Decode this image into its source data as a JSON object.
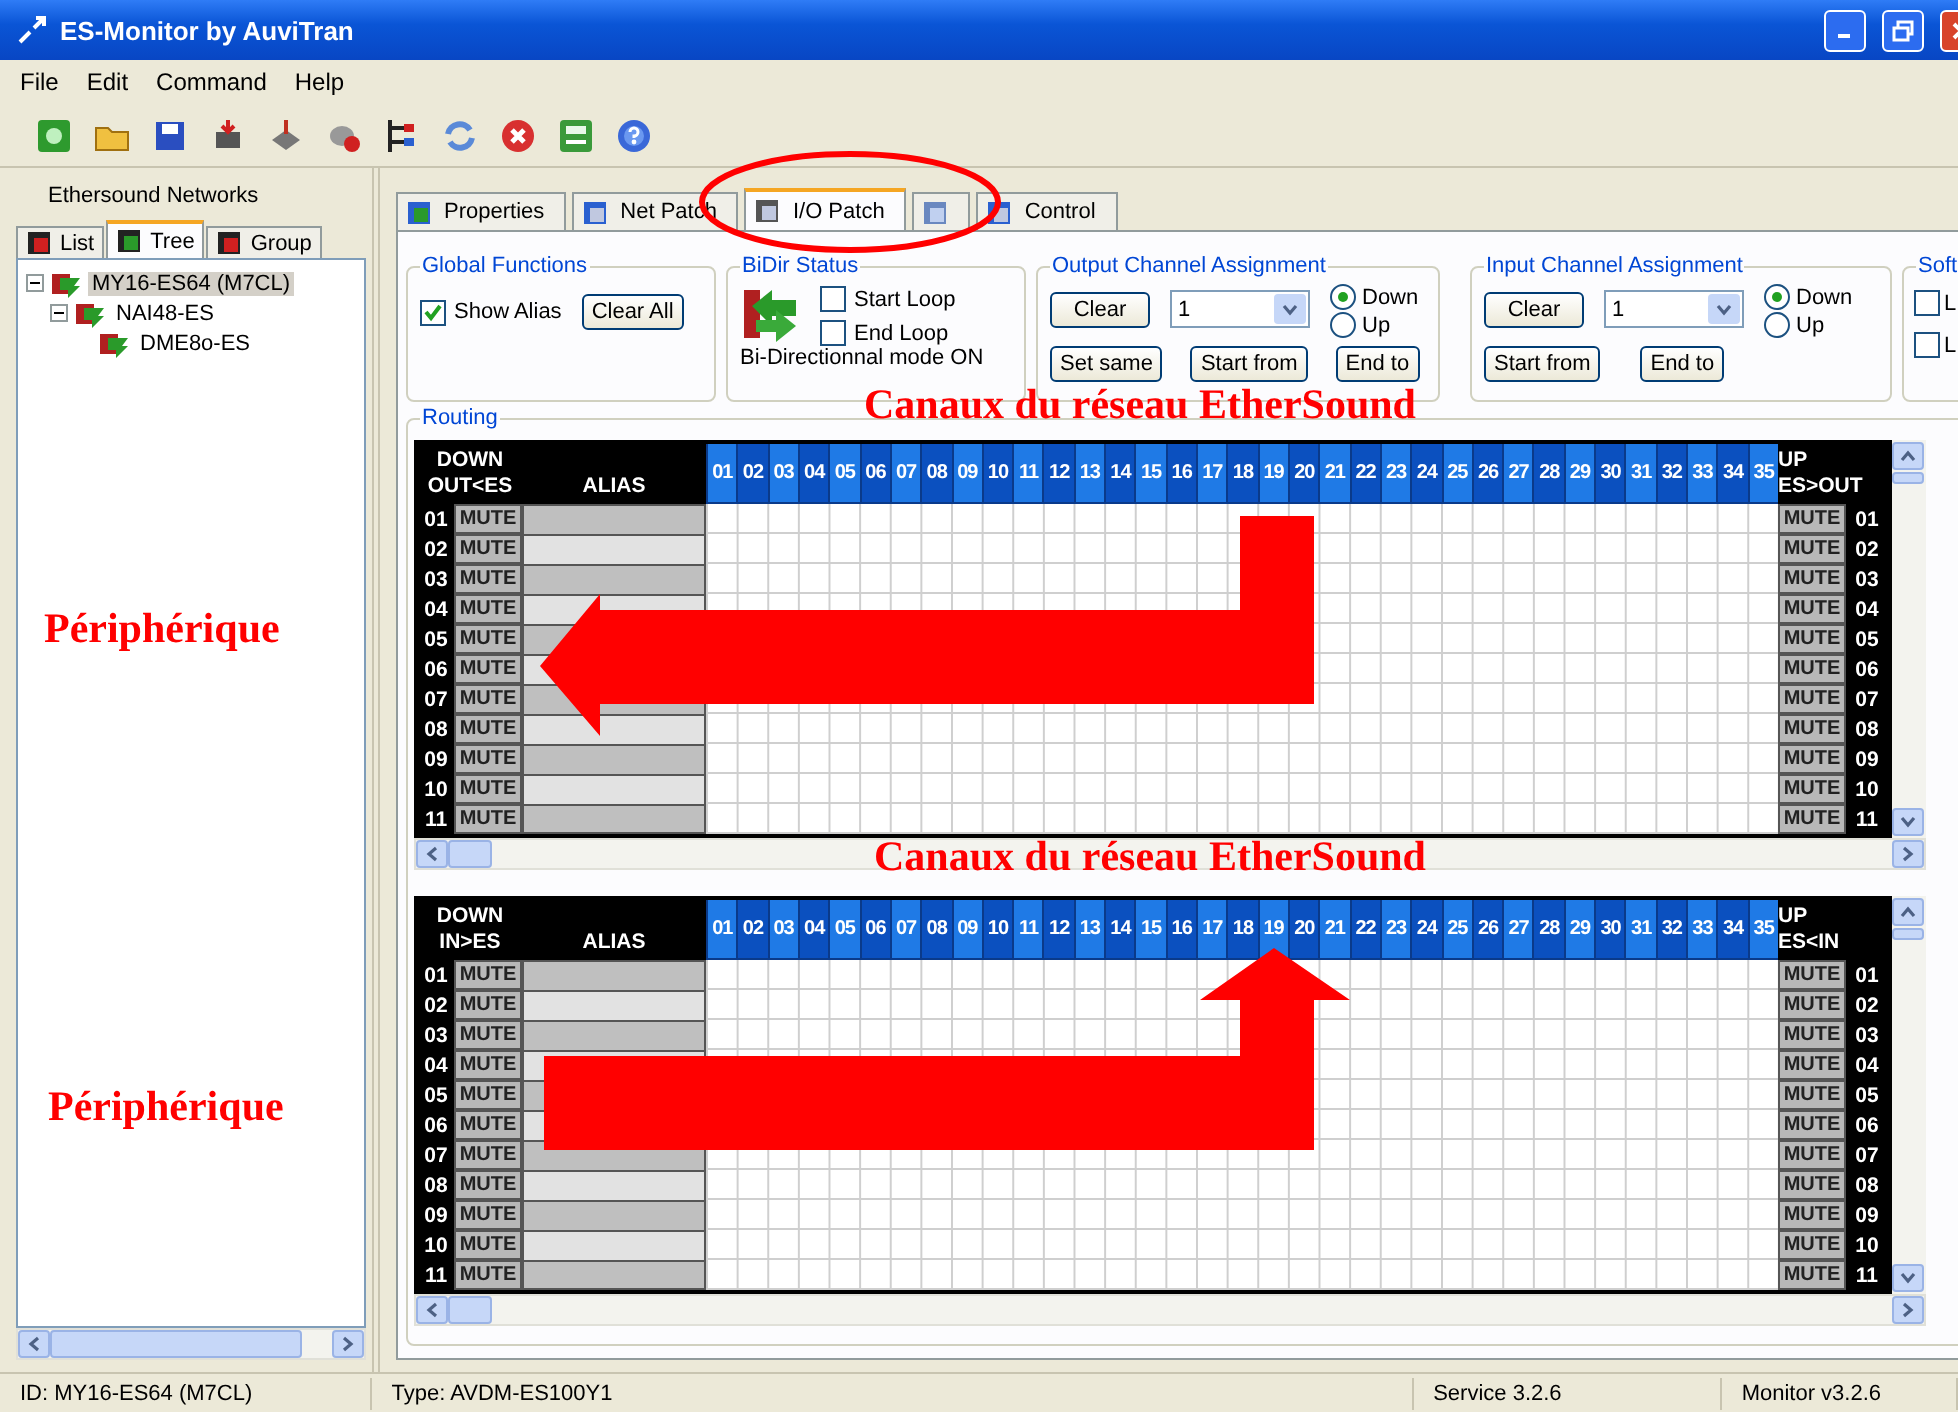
{
  "window": {
    "title": "ES-Monitor by AuviTran"
  },
  "menu": [
    "File",
    "Edit",
    "Command",
    "Help"
  ],
  "sidebar": {
    "title": "Ethersound Networks",
    "tabs": [
      {
        "label": "List",
        "selected": false
      },
      {
        "label": "Tree",
        "selected": true
      },
      {
        "label": "Group",
        "selected": false
      }
    ],
    "tree": [
      {
        "label": "MY16-ES64 (M7CL)",
        "selected": true,
        "expanded": true,
        "children": [
          {
            "label": "NAI48-ES",
            "selected": false,
            "expanded": true,
            "children": [
              {
                "label": "DME8o-ES",
                "selected": false
              }
            ]
          }
        ]
      }
    ]
  },
  "tabs": [
    {
      "kind": "text",
      "label": "Properties",
      "selected": false
    },
    {
      "kind": "text",
      "label": "Net Patch",
      "selected": false
    },
    {
      "kind": "text",
      "label": "I/O Patch",
      "selected": true
    },
    {
      "kind": "icon",
      "selected": false
    },
    {
      "kind": "text",
      "label": "Control",
      "selected": false
    }
  ],
  "global_functions": {
    "title": "Global Functions",
    "show_alias": {
      "label": "Show Alias",
      "checked": true
    },
    "button": "Clear All"
  },
  "bidir_status": {
    "title": "BiDir Status",
    "start_loop": {
      "label": "Start Loop",
      "checked": false
    },
    "end_loop": {
      "label": "End Loop",
      "checked": false
    },
    "mode": "Bi-Directionnal mode ON"
  },
  "assignments": [
    {
      "title": "Output Channel Assignment",
      "clear": "Clear",
      "value": "1",
      "radios": [
        {
          "label": "Down",
          "selected": true
        },
        {
          "label": "Up",
          "selected": false
        }
      ],
      "buttons": [
        "Set same",
        "Start from",
        "End to"
      ]
    },
    {
      "title": "Input Channel Assignment",
      "clear": "Clear",
      "value": "1",
      "radios": [
        {
          "label": "Down",
          "selected": true
        },
        {
          "label": "Up",
          "selected": false
        }
      ],
      "buttons": [
        "Start from",
        "End to"
      ]
    }
  ],
  "soft": {
    "title": "Soft",
    "checkboxes": [
      {
        "label": "L",
        "checked": false
      },
      {
        "label": "L",
        "checked": false
      }
    ]
  },
  "routing": {
    "title": "Routing",
    "grids": [
      {
        "left_top": "DOWN",
        "left_bottom": "OUT<ES",
        "alias": "ALIAS",
        "right_top": "UP",
        "right_bottom": "ES>OUT",
        "channels": [
          "01",
          "02",
          "03",
          "04",
          "05",
          "06",
          "07",
          "08",
          "09",
          "10",
          "11",
          "12",
          "13",
          "14",
          "15",
          "16",
          "17",
          "18",
          "19",
          "20",
          "21",
          "22",
          "23",
          "24",
          "25",
          "26",
          "27",
          "28",
          "29",
          "30",
          "31",
          "32",
          "33",
          "34",
          "35"
        ],
        "rows": [
          {
            "left_number": "01",
            "left_mute": "MUTE",
            "right_mute": "MUTE",
            "right_number": "01"
          },
          {
            "left_number": "02",
            "left_mute": "MUTE",
            "right_mute": "MUTE",
            "right_number": "02"
          },
          {
            "left_number": "03",
            "left_mute": "MUTE",
            "right_mute": "MUTE",
            "right_number": "03"
          },
          {
            "left_number": "04",
            "left_mute": "MUTE",
            "right_mute": "MUTE",
            "right_number": "04"
          },
          {
            "left_number": "05",
            "left_mute": "MUTE",
            "right_mute": "MUTE",
            "right_number": "05"
          },
          {
            "left_number": "06",
            "left_mute": "MUTE",
            "right_mute": "MUTE",
            "right_number": "06"
          },
          {
            "left_number": "07",
            "left_mute": "MUTE",
            "right_mute": "MUTE",
            "right_number": "07"
          },
          {
            "left_number": "08",
            "left_mute": "MUTE",
            "right_mute": "MUTE",
            "right_number": "08"
          },
          {
            "left_number": "09",
            "left_mute": "MUTE",
            "right_mute": "MUTE",
            "right_number": "09"
          },
          {
            "left_number": "10",
            "left_mute": "MUTE",
            "right_mute": "MUTE",
            "right_number": "10"
          },
          {
            "left_number": "11",
            "left_mute": "MUTE",
            "right_mute": "MUTE",
            "right_number": "11"
          }
        ]
      },
      {
        "left_top": "DOWN",
        "left_bottom": "IN>ES",
        "alias": "ALIAS",
        "right_top": "UP",
        "right_bottom": "ES<IN",
        "channels": [
          "01",
          "02",
          "03",
          "04",
          "05",
          "06",
          "07",
          "08",
          "09",
          "10",
          "11",
          "12",
          "13",
          "14",
          "15",
          "16",
          "17",
          "18",
          "19",
          "20",
          "21",
          "22",
          "23",
          "24",
          "25",
          "26",
          "27",
          "28",
          "29",
          "30",
          "31",
          "32",
          "33",
          "34",
          "35"
        ],
        "rows": [
          {
            "left_number": "01",
            "left_mute": "MUTE",
            "right_mute": "MUTE",
            "right_number": "01"
          },
          {
            "left_number": "02",
            "left_mute": "MUTE",
            "right_mute": "MUTE",
            "right_number": "02"
          },
          {
            "left_number": "03",
            "left_mute": "MUTE",
            "right_mute": "MUTE",
            "right_number": "03"
          },
          {
            "left_number": "04",
            "left_mute": "MUTE",
            "right_mute": "MUTE",
            "right_number": "04"
          },
          {
            "left_number": "05",
            "left_mute": "MUTE",
            "right_mute": "MUTE",
            "right_number": "05"
          },
          {
            "left_number": "06",
            "left_mute": "MUTE",
            "right_mute": "MUTE",
            "right_number": "06"
          },
          {
            "left_number": "07",
            "left_mute": "MUTE",
            "right_mute": "MUTE",
            "right_number": "07"
          },
          {
            "left_number": "08",
            "left_mute": "MUTE",
            "right_mute": "MUTE",
            "right_number": "08"
          },
          {
            "left_number": "09",
            "left_mute": "MUTE",
            "right_mute": "MUTE",
            "right_number": "09"
          },
          {
            "left_number": "10",
            "left_mute": "MUTE",
            "right_mute": "MUTE",
            "right_number": "10"
          },
          {
            "left_number": "11",
            "left_mute": "MUTE",
            "right_mute": "MUTE",
            "right_number": "11"
          }
        ]
      }
    ]
  },
  "annotations": [
    "Canaux du réseau EtherSound",
    "Canaux du réseau EtherSound",
    "Périphérique",
    "Périphérique"
  ],
  "status_bar": [
    "ID: MY16-ES64 (M7CL)",
    "Type: AVDM-ES100Y1",
    "Service 3.2.6",
    "Monitor v3.2.6"
  ]
}
